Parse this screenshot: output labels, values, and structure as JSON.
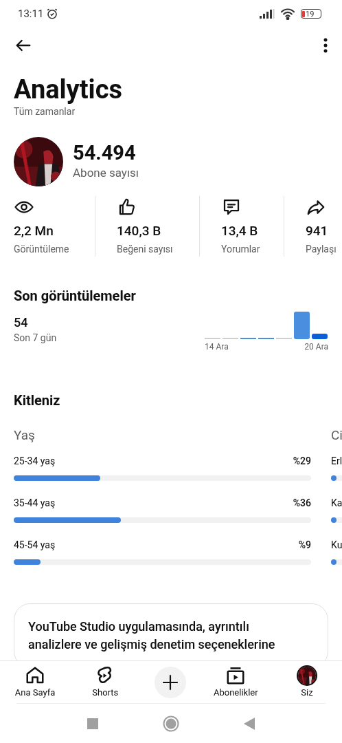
{
  "status_bar": {
    "time": "13:11",
    "battery": "19"
  },
  "header": {
    "title": "Analytics",
    "subtitle": "Tüm zamanlar"
  },
  "subscribers": {
    "count": "54.494",
    "label": "Abone sayısı"
  },
  "stats": [
    {
      "kind": "views",
      "value": "2,2 Mn",
      "label": "Görüntüleme"
    },
    {
      "kind": "likes",
      "value": "140,3 B",
      "label": "Beğeni sayısı"
    },
    {
      "kind": "comments",
      "value": "13,4 B",
      "label": "Yorumlar"
    },
    {
      "kind": "shares",
      "value": "941",
      "label": "Paylaşı"
    }
  ],
  "recent_views": {
    "title": "Son görüntülemeler",
    "count": "54",
    "period": "Son 7 gün",
    "x_labels": [
      "14 Ara",
      "20 Ara"
    ]
  },
  "audience": {
    "title": "Kitleniz",
    "age": {
      "title": "Yaş",
      "rows": [
        {
          "label": "25-34 yaş",
          "value": "%29",
          "level": 0.29
        },
        {
          "label": "35-44 yaş",
          "value": "%36",
          "level": 0.36
        },
        {
          "label": "45-54 yaş",
          "value": "%9",
          "level": 0.09
        }
      ]
    },
    "gender": {
      "title": "Ci",
      "rows": [
        {
          "label": "Erl"
        },
        {
          "label": "Ka"
        },
        {
          "label": "Ku"
        }
      ]
    }
  },
  "promo": {
    "text": "YouTube Studio uygulamasında, ayrıntılı analizlere ve gelişmiş denetim seçeneklerine"
  },
  "bottom_nav": [
    {
      "kind": "home",
      "label": "Ana Sayfa"
    },
    {
      "kind": "shorts",
      "label": "Shorts"
    },
    {
      "kind": "create"
    },
    {
      "kind": "subscriptions",
      "label": "Abonelikler"
    },
    {
      "kind": "you",
      "label": "Siz"
    }
  ]
}
